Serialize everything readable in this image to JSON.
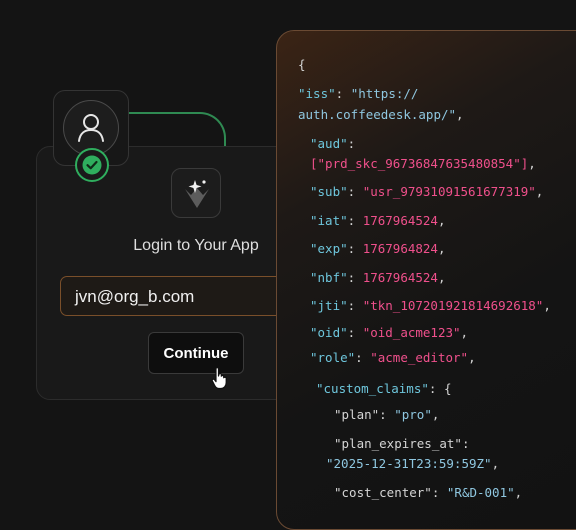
{
  "login": {
    "title": "Login to Your App",
    "email_value": "jvn@org_b.com",
    "continue_label": "Continue"
  },
  "icons": {
    "avatar": "user-icon",
    "verified": "check-circle-icon",
    "app_logo": "sparkle-logo-icon",
    "cursor": "hand-pointer-icon"
  },
  "colors": {
    "accent_orange": "#7a4f2a",
    "success_green": "#2fae5e",
    "json_key": "#6ec6dc",
    "json_value": "#f0508c",
    "json_string": "#8fc7e0"
  },
  "token": {
    "open_brace": "{",
    "lines": [
      {
        "key": "\"iss\"",
        "sep": ": ",
        "val": "\"https://"
      },
      {
        "val": "auth.coffeedesk.app/\"",
        "tail": ","
      },
      {
        "key": "\"aud\"",
        "sep": ":"
      },
      {
        "val": "[\"prd_skc_96736847635480854\"]",
        "tail": ","
      },
      {
        "key": "\"sub\"",
        "sep": ": ",
        "val": "\"usr_97931091561677319\"",
        "tail": ","
      },
      {
        "key": "\"iat\"",
        "sep": ": ",
        "val": "1767964524",
        "tail": ","
      },
      {
        "key": "\"exp\"",
        "sep": ": ",
        "val": "1767964824",
        "tail": ","
      },
      {
        "key": "\"nbf\"",
        "sep": ": ",
        "val": "1767964524",
        "tail": ","
      },
      {
        "key": "\"jti\"",
        "sep": ": ",
        "val": "\"tkn_107201921814692618\"",
        "tail": ","
      },
      {
        "key": "\"oid\"",
        "sep": ": ",
        "val": "\"oid_acme123\"",
        "tail": ","
      },
      {
        "key": "\"role\"",
        "sep": ": ",
        "val": "\"acme_editor\"",
        "tail": ","
      },
      {
        "key": "\"custom_claims\"",
        "sep": ": {"
      },
      {
        "key": "\"plan\"",
        "sep": ": ",
        "val": "\"pro\"",
        "tail": ","
      },
      {
        "key": "\"plan_expires_at\"",
        "sep": ":"
      },
      {
        "val": "\"2025-12-31T23:59:59Z\"",
        "tail": ","
      },
      {
        "key": "\"cost_center\"",
        "sep": ": ",
        "val": "\"R&D-001\"",
        "tail": ","
      }
    ]
  }
}
